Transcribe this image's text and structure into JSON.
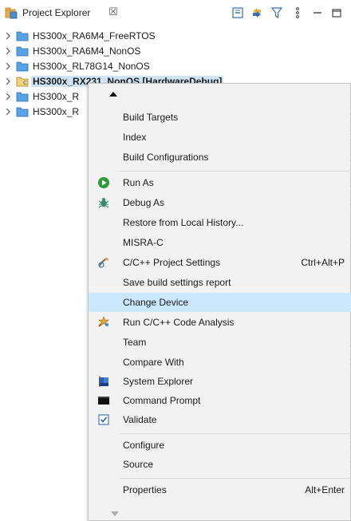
{
  "view": {
    "title": "Project Explorer",
    "close_glyph": "☒"
  },
  "tree": {
    "items": [
      {
        "label": "HS300x_RA6M4_FreeRTOS"
      },
      {
        "label": "HS300x_RA6M4_NonOS"
      },
      {
        "label": "HS300x_RL78G14_NonOS"
      },
      {
        "label": "HS300x_RX231_NonOS [HardwareDebug]",
        "prefix": "HS300x_R",
        "suffix": "X231_NonOS [HardwareDebug]"
      },
      {
        "label": "HS300x_R"
      },
      {
        "label": "HS300x_R"
      }
    ]
  },
  "menu": {
    "items": [
      {
        "label": "Build Targets",
        "submenu": true
      },
      {
        "label": "Index",
        "submenu": true
      },
      {
        "label": "Build Configurations",
        "submenu": true
      },
      {
        "label": "Run As",
        "submenu": true,
        "icon": "run-icon"
      },
      {
        "label": "Debug As",
        "submenu": true,
        "icon": "debug-bug-icon"
      },
      {
        "label": "Restore from Local History..."
      },
      {
        "label": "MISRA-C",
        "submenu": true
      },
      {
        "label": "C/C++ Project Settings",
        "accel": "Ctrl+Alt+P",
        "icon": "settings-icon"
      },
      {
        "label": "Save build settings report"
      },
      {
        "label": "Change Device",
        "highlighted": true
      },
      {
        "label": "Run C/C++ Code Analysis",
        "icon": "code-analysis-icon"
      },
      {
        "label": "Team",
        "submenu": true
      },
      {
        "label": "Compare With",
        "submenu": true
      },
      {
        "label": "System Explorer",
        "icon": "system-explorer-icon"
      },
      {
        "label": "Command Prompt",
        "icon": "command-prompt-icon"
      },
      {
        "label": "Validate",
        "icon": "validate-checkbox-icon"
      },
      {
        "label": "Configure",
        "submenu": true
      },
      {
        "label": "Source",
        "submenu": true
      },
      {
        "label": "Properties",
        "accel": "Alt+Enter"
      }
    ]
  },
  "colors": {
    "highlight": "#cce8ff",
    "selection": "#cfe5f6",
    "menu_bg": "#f2f2f2",
    "run_green": "#2e9b3b"
  }
}
